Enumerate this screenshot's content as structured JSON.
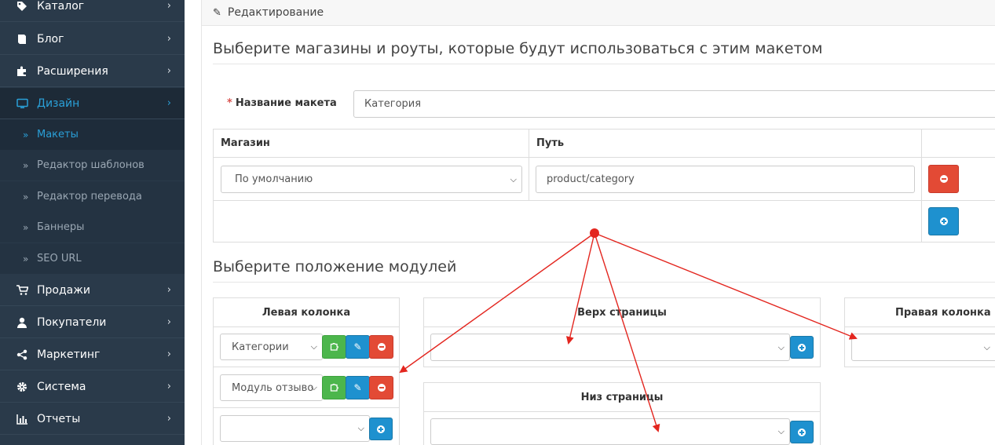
{
  "sidebar": {
    "items": [
      {
        "label": "Каталог",
        "icon": "tag-icon"
      },
      {
        "label": "Блог",
        "icon": "book-icon"
      },
      {
        "label": "Расширения",
        "icon": "puzzle-icon"
      },
      {
        "label": "Дизайн",
        "icon": "monitor-icon"
      },
      {
        "label": "Продажи",
        "icon": "cart-icon"
      },
      {
        "label": "Покупатели",
        "icon": "user-icon"
      },
      {
        "label": "Маркетинг",
        "icon": "share-icon"
      },
      {
        "label": "Система",
        "icon": "gear-icon"
      },
      {
        "label": "Отчеты",
        "icon": "bar-chart-icon"
      }
    ],
    "design_submenu": [
      "Макеты",
      "Редактор шаблонов",
      "Редактор перевода",
      "Баннеры",
      "SEO URL"
    ],
    "active_item": "Дизайн",
    "active_subitem": "Макеты"
  },
  "panel": {
    "title": "Редактирование"
  },
  "stores_section": {
    "legend": "Выберите магазины и роуты, которые будут использоваться с этим макетом",
    "layout_name_label": "Название макета",
    "layout_name_value": "Категория",
    "table_headers": [
      "Магазин",
      "Путь"
    ],
    "rows": [
      {
        "store": "По умолчанию",
        "route": "product/category"
      }
    ]
  },
  "modules_section": {
    "legend": "Выберите положение модулей",
    "left_column": {
      "title": "Левая колонка",
      "modules": [
        "Категории",
        "Модуль отзыво"
      ]
    },
    "top_page": {
      "title": "Верх страницы"
    },
    "bottom_page": {
      "title": "Низ страницы"
    },
    "right_column": {
      "title": "Правая колонка"
    }
  },
  "colors": {
    "sidebar_bg": "#2a3a4a",
    "accent": "#2aa0d8",
    "danger": "#e34a35",
    "primary": "#1e91cf",
    "success": "#4cb64c",
    "annotation": "#e3261f"
  }
}
